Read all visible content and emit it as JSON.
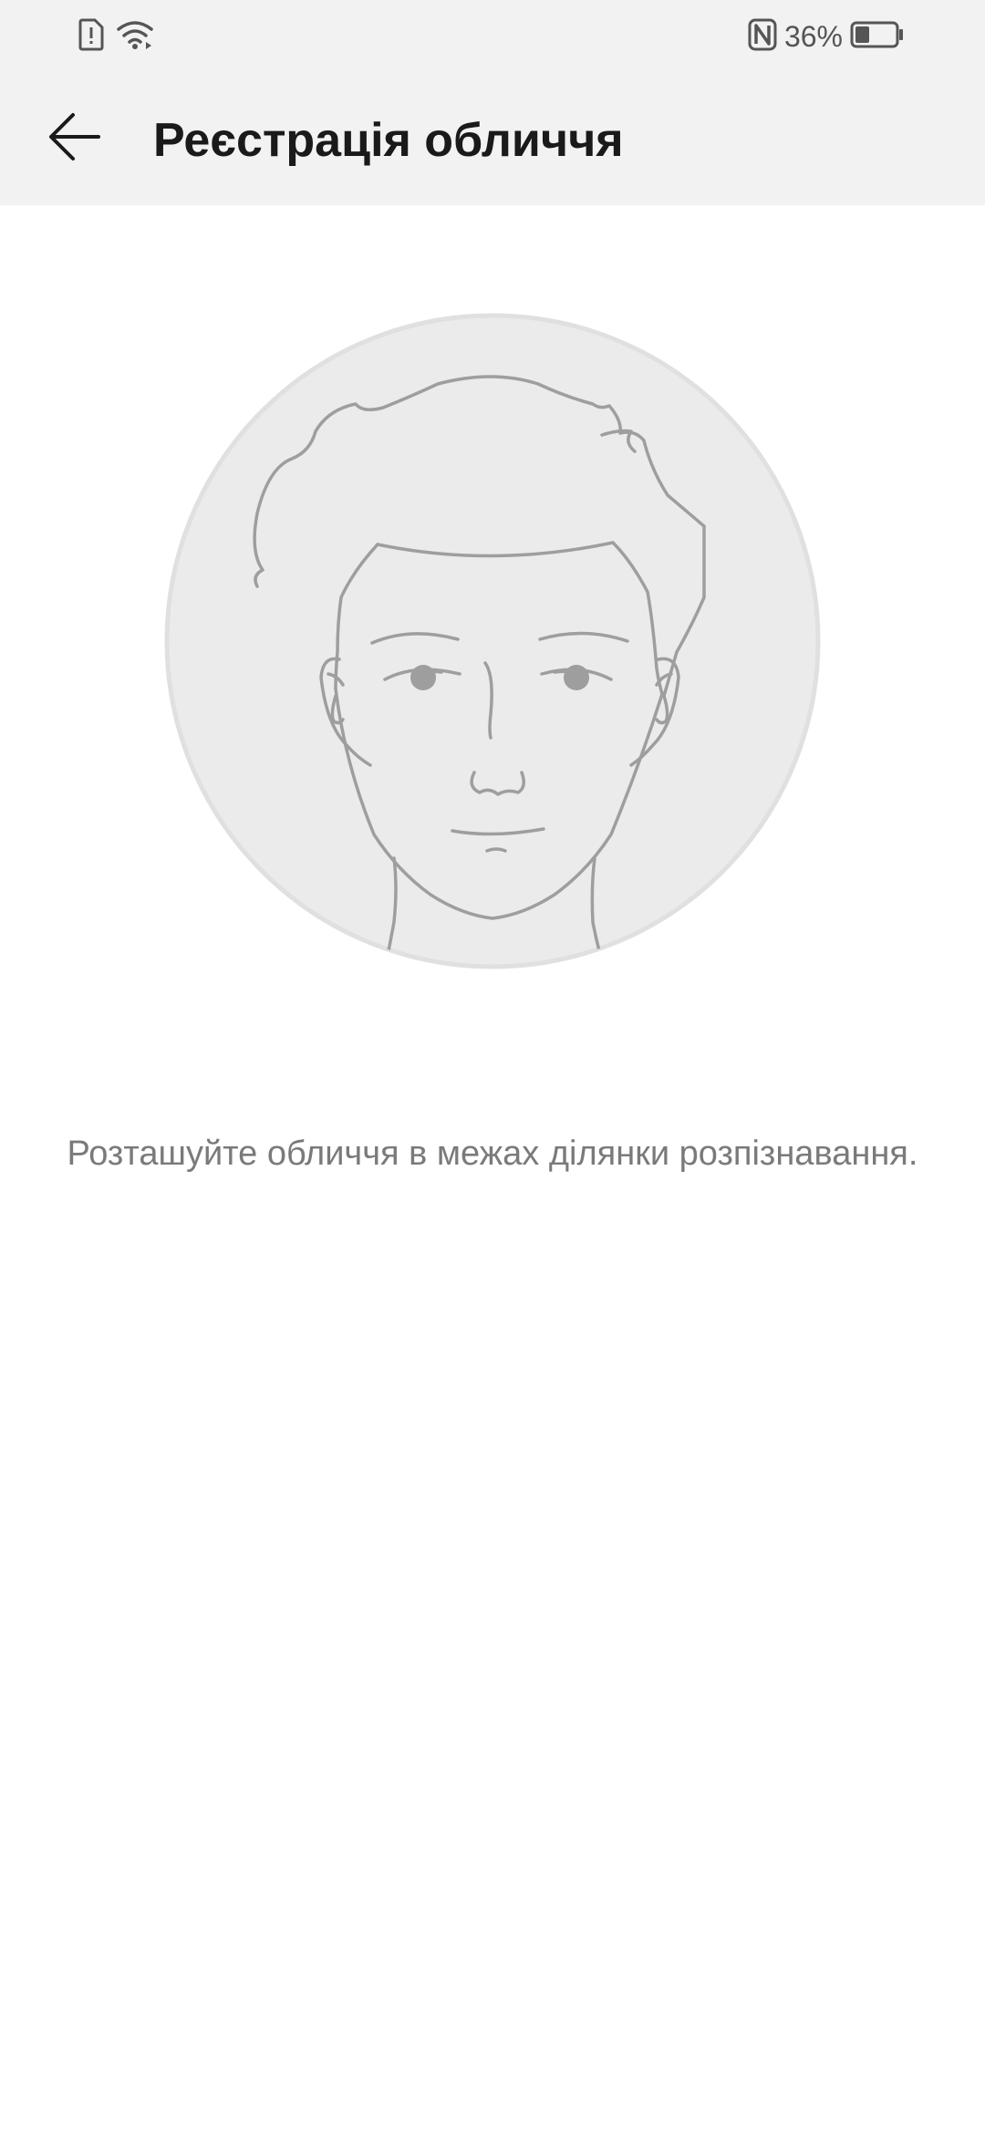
{
  "status_bar": {
    "battery_percent": "36%",
    "battery_level": 0.36,
    "icons": [
      "sim-alert-icon",
      "wifi-icon",
      "nfc-icon",
      "battery-icon"
    ]
  },
  "app_bar": {
    "back_icon": "arrow-left-icon",
    "title": "Реєстрація обличчя"
  },
  "main": {
    "illustration": "face-outline-icon",
    "instruction": "Розташуйте обличчя в межах ділянки розпізнавання."
  },
  "colors": {
    "bar_background": "#f2f2f2",
    "title_text": "#1a1a1a",
    "instruction_text": "#7a7a7a",
    "circle_fill": "#ebebeb",
    "face_stroke": "#9e9e9e"
  }
}
